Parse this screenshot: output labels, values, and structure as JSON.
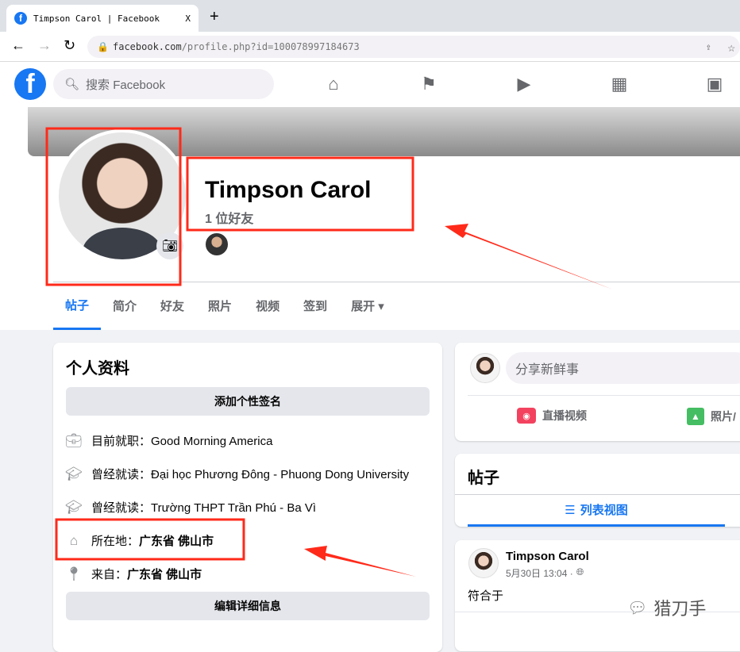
{
  "browser": {
    "tab_title": "Timpson Carol | Facebook",
    "tab_close": "X",
    "new_tab": "+",
    "url_host": "facebook.com",
    "url_path": "/profile.php?id=100078997184673"
  },
  "fb": {
    "logo": "f",
    "search_placeholder": "搜索 Facebook"
  },
  "profile": {
    "name": "Timpson Carol",
    "friends": "1 位好友",
    "tabs": [
      "帖子",
      "简介",
      "好友",
      "照片",
      "视频",
      "签到",
      "展开 ▾"
    ]
  },
  "intro": {
    "title": "个人资料",
    "add_bio": "添加个性签名",
    "items": [
      {
        "icon": "briefcase-icon",
        "label": "目前就职：",
        "value": "Good Morning America"
      },
      {
        "icon": "graduation-cap-icon",
        "label": "曾经就读：",
        "value": "Đại học Phương Đông - Phuong Dong University"
      },
      {
        "icon": "graduation-cap-icon",
        "label": "曾经就读：",
        "value": "Trường THPT Trần Phú - Ba Vì"
      },
      {
        "icon": "home-icon",
        "label": "所在地：",
        "value": "广东省 佛山市"
      },
      {
        "icon": "location-pin-icon",
        "label": "来自：",
        "value": "广东省 佛山市"
      }
    ],
    "edit_details": "编辑详细信息"
  },
  "composer": {
    "placeholder": "分享新鲜事",
    "live_video": "直播视频",
    "photo": "照片/"
  },
  "posts": {
    "title": "帖子",
    "list_view": "列表视图"
  },
  "post": {
    "author": "Timpson Carol",
    "time": "5月30日 13:04 ·",
    "text": "符合于"
  },
  "watermark": "猎刀手",
  "colors": {
    "accent": "#1877f2",
    "annotation": "#ff2a1a"
  }
}
